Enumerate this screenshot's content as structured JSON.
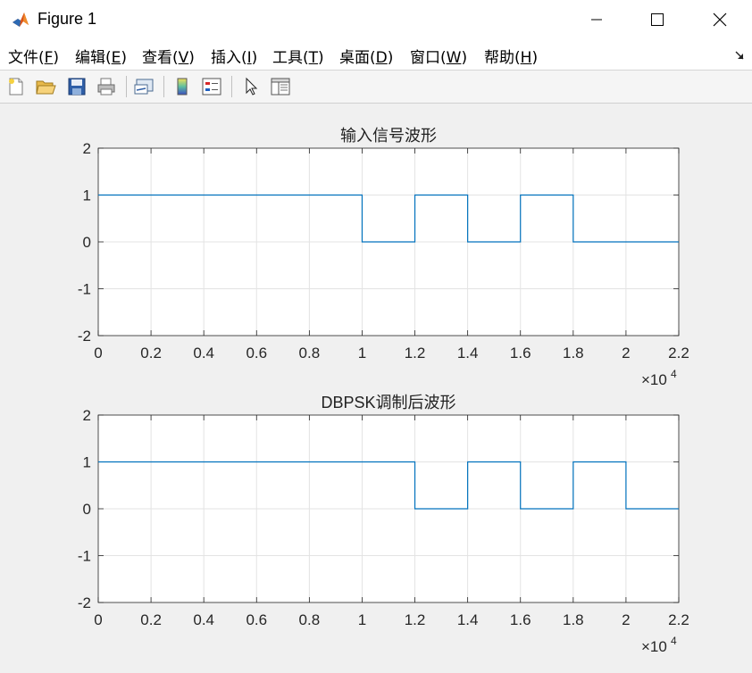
{
  "window": {
    "title": "Figure 1",
    "controls": {
      "minimize": "–",
      "maximize": "☐",
      "close": "✕"
    }
  },
  "menu": [
    {
      "text": "文件(",
      "key": "F",
      "end": ")"
    },
    {
      "text": "编辑(",
      "key": "E",
      "end": ")"
    },
    {
      "text": "查看(",
      "key": "V",
      "end": ")"
    },
    {
      "text": "插入(",
      "key": "I",
      "end": ")"
    },
    {
      "text": "工具(",
      "key": "T",
      "end": ")"
    },
    {
      "text": "桌面(",
      "key": "D",
      "end": ")"
    },
    {
      "text": "窗口(",
      "key": "W",
      "end": ")"
    },
    {
      "text": "帮助(",
      "key": "H",
      "end": ")"
    }
  ],
  "toolbar": {
    "buttons": [
      "new-figure-icon",
      "open-file-icon",
      "save-icon",
      "print-icon",
      "link-plot-icon",
      "colorbar-icon",
      "legend-icon",
      "pointer-icon",
      "property-inspector-icon"
    ]
  },
  "colors": {
    "line": "#0072bd",
    "grid": "#e3e3e3",
    "axis": "#262626"
  },
  "chart_data": [
    {
      "type": "line",
      "step": true,
      "title": "输入信号波形",
      "xlabel": "",
      "ylabel": "",
      "xlim": [
        0,
        22000
      ],
      "ylim": [
        -2,
        2
      ],
      "x_exponent_label": "×10",
      "x_exponent": "4",
      "xticks": [
        0,
        0.2,
        0.4,
        0.6,
        0.8,
        1,
        1.2,
        1.4,
        1.6,
        1.8,
        2,
        2.2
      ],
      "yticks": [
        2,
        1,
        0,
        -1,
        -2
      ],
      "grid": true,
      "series": [
        {
          "x": [
            0,
            10000,
            10000,
            12000,
            12000,
            14000,
            14000,
            16000,
            16000,
            18000,
            18000,
            22000
          ],
          "y": [
            1,
            1,
            0,
            0,
            1,
            1,
            0,
            0,
            1,
            1,
            0,
            0
          ]
        }
      ]
    },
    {
      "type": "line",
      "step": true,
      "title": "DBPSK调制后波形",
      "xlabel": "",
      "ylabel": "",
      "xlim": [
        0,
        22000
      ],
      "ylim": [
        -2,
        2
      ],
      "x_exponent_label": "×10",
      "x_exponent": "4",
      "xticks": [
        0,
        0.2,
        0.4,
        0.6,
        0.8,
        1,
        1.2,
        1.4,
        1.6,
        1.8,
        2,
        2.2
      ],
      "yticks": [
        2,
        1,
        0,
        -1,
        -2
      ],
      "grid": true,
      "series": [
        {
          "x": [
            0,
            12000,
            12000,
            14000,
            14000,
            16000,
            16000,
            18000,
            18000,
            20000,
            20000,
            22000
          ],
          "y": [
            1,
            1,
            0,
            0,
            1,
            1,
            0,
            0,
            1,
            1,
            0,
            0
          ]
        }
      ]
    }
  ]
}
